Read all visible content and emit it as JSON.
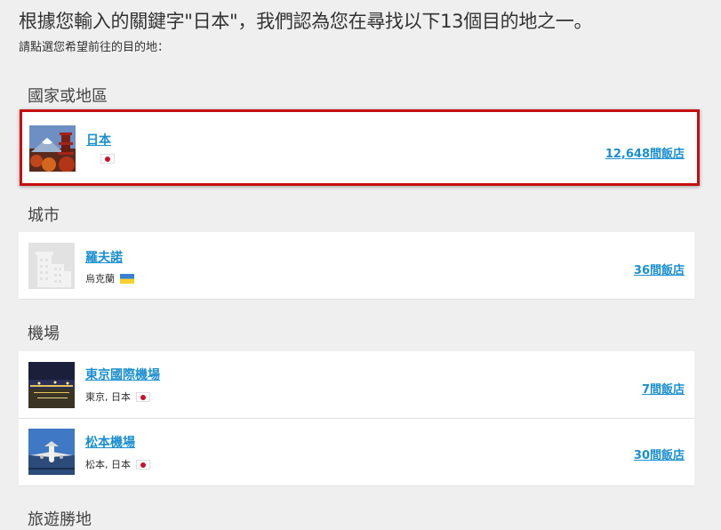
{
  "header": {
    "headline": "根據您輸入的關鍵字\"日本\"，我們認為您在尋找以下13個目的地之一。",
    "subline": "請點選您希望前往的目的地："
  },
  "sections": {
    "country": {
      "title": "國家或地區",
      "items": [
        {
          "name": "日本",
          "location": "",
          "flag": "flag-jp-icon",
          "hotels": "12,648間飯店",
          "thumb": "mount-fuji-pagoda-photo",
          "highlighted": true
        }
      ]
    },
    "city": {
      "title": "城市",
      "items": [
        {
          "name": "羅夫諾",
          "location": "烏克蘭",
          "flag": "flag-ua-icon",
          "hotels": "36間飯店",
          "thumb": "city-placeholder-icon"
        }
      ]
    },
    "airport": {
      "title": "機場",
      "items": [
        {
          "name": "東京國際機場",
          "location": "東京, 日本",
          "flag": "flag-jp-icon",
          "hotels": "7間飯店",
          "thumb": "airport-night-photo"
        },
        {
          "name": "松本機場",
          "location": "松本, 日本",
          "flag": "flag-jp-icon",
          "hotels": "30間飯店",
          "thumb": "airplane-photo"
        }
      ]
    },
    "attraction": {
      "title": "旅遊勝地"
    }
  },
  "colors": {
    "link": "#1a8fd0",
    "highlight_border": "#c60e0e",
    "background": "#efefef"
  }
}
